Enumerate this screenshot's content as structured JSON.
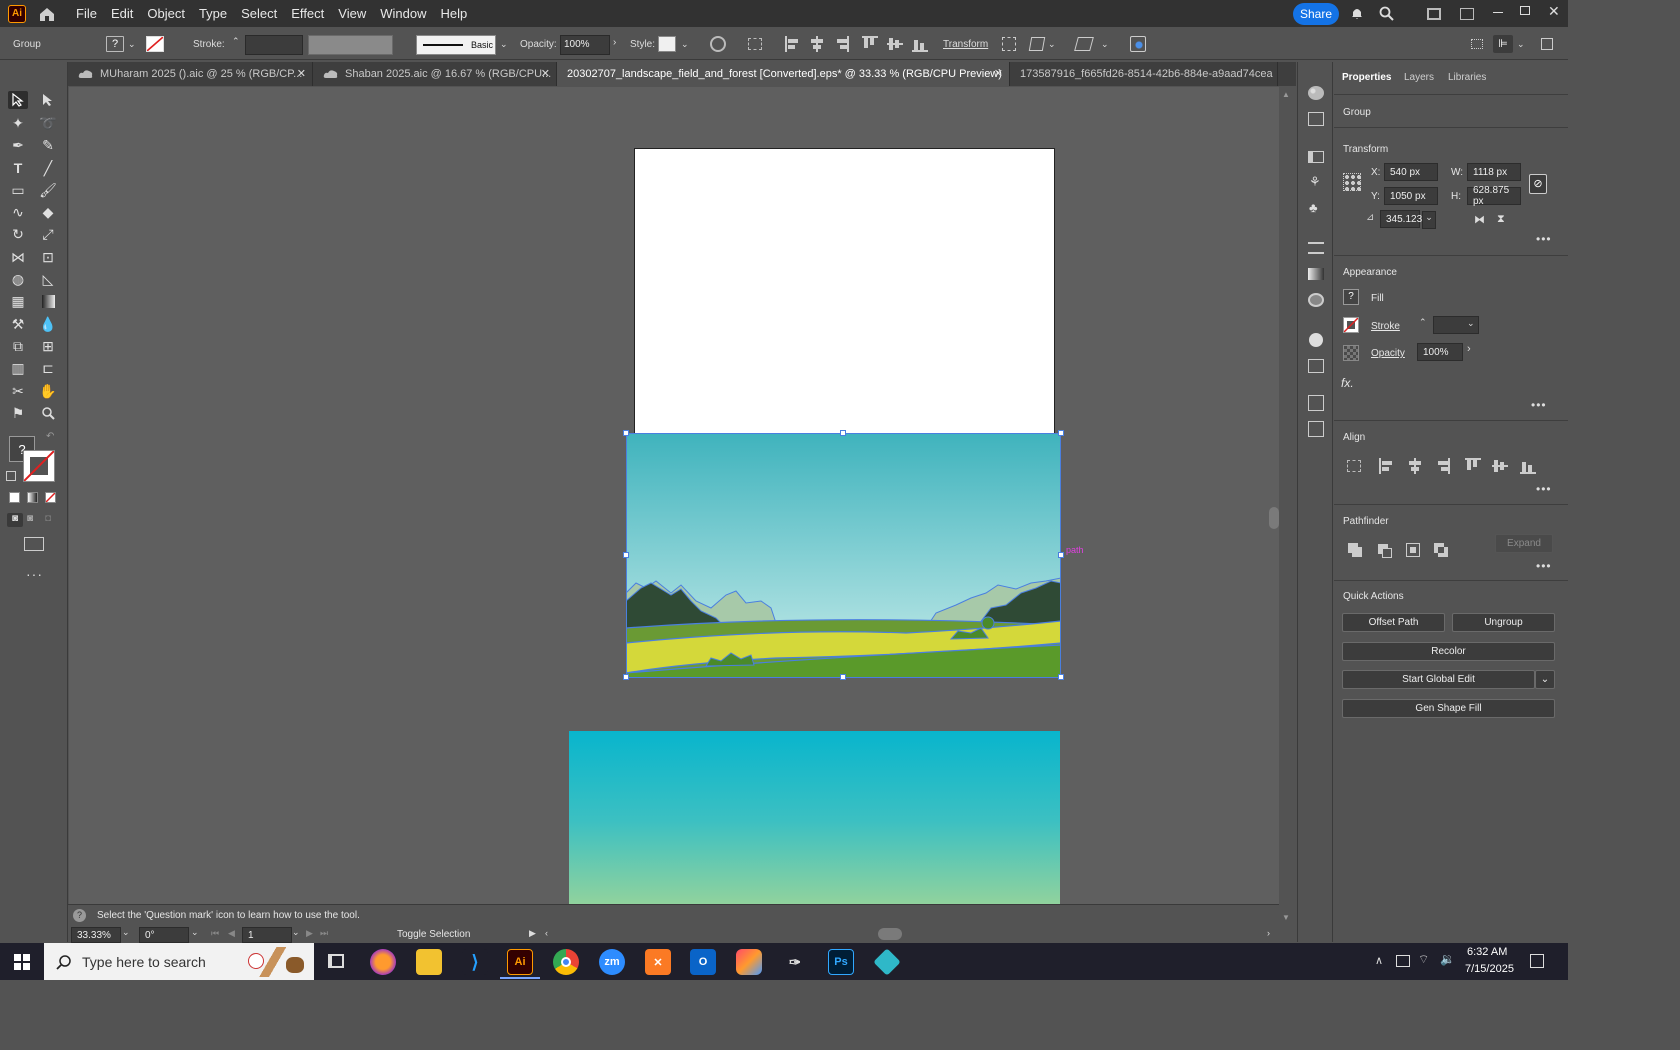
{
  "menubar": {
    "app_logo": "Ai",
    "menus": [
      "File",
      "Edit",
      "Object",
      "Type",
      "Select",
      "Effect",
      "View",
      "Window",
      "Help"
    ],
    "share": "Share"
  },
  "controlbar": {
    "selection": "Group",
    "stroke_label": "Stroke:",
    "brush_label": "Basic",
    "opacity_label": "Opacity:",
    "opacity_value": "100%",
    "style_label": "Style:",
    "transform_label": "Transform"
  },
  "tabs": [
    {
      "label": "MUharam 2025 ().aic @ 25 % (RGB/CP..."
    },
    {
      "label": "Shaban 2025.aic @ 16.67 % (RGB/CPU..."
    },
    {
      "label": "20302707_landscape_field_and_forest [Converted].eps* @ 33.33 % (RGB/CPU Preview)"
    },
    {
      "label": "173587916_f665fd26-8514-42b6-884e-a9aad74cea"
    }
  ],
  "canvas": {
    "hover_label": "path"
  },
  "properties": {
    "tabs": [
      "Properties",
      "Layers",
      "Libraries"
    ],
    "selection_type": "Group",
    "transform": {
      "title": "Transform",
      "x_label": "X:",
      "x": "540 px",
      "y_label": "Y:",
      "y": "1050 px",
      "w_label": "W:",
      "w": "1118 px",
      "h_label": "H:",
      "h": "628.875 px",
      "angle": "345.123"
    },
    "appearance": {
      "title": "Appearance",
      "fill": "Fill",
      "stroke": "Stroke",
      "opacity": "Opacity",
      "opacity_value": "100%",
      "fx": "fx."
    },
    "align": {
      "title": "Align"
    },
    "pathfinder": {
      "title": "Pathfinder",
      "expand": "Expand"
    },
    "quick_actions": {
      "title": "Quick Actions",
      "offset_path": "Offset Path",
      "ungroup": "Ungroup",
      "recolor": "Recolor",
      "start_global_edit": "Start Global Edit",
      "gen_shape_fill": "Gen Shape Fill"
    }
  },
  "statusbar": {
    "hint": "Select the 'Question mark' icon to learn how to use the tool.",
    "zoom": "33.33%",
    "rotation": "0°",
    "artboard": "1",
    "toggle": "Toggle Selection"
  },
  "taskbar": {
    "search_placeholder": "Type here to search",
    "time": "6:32 AM",
    "date": "7/15/2025",
    "apps": [
      "Ai",
      "Ps",
      "zm"
    ]
  },
  "colors": {
    "accent": "#1473e6",
    "selection": "#4a7fe0",
    "sky_top": "#3fb3bd",
    "sky_bottom": "#bfe8e8",
    "hill_dark": "#2f4a35",
    "field_yellow": "#d4d83a",
    "field_green": "#5a9a2a"
  }
}
